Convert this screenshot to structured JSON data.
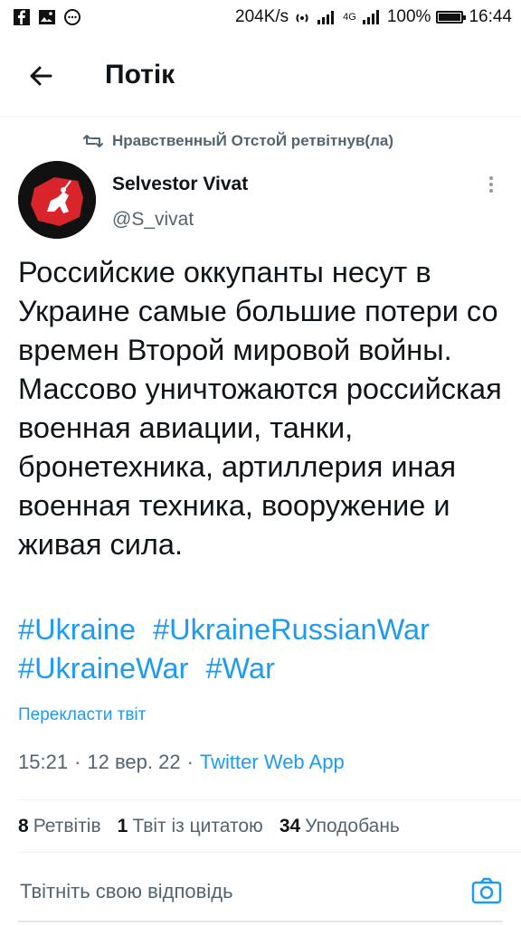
{
  "status_bar": {
    "speed": "204K/s",
    "network": "4G",
    "battery": "100%",
    "time": "16:44",
    "battery_level": 1.0,
    "left_icons": [
      "facebook-icon",
      "image-icon",
      "chat-icon"
    ]
  },
  "header": {
    "title": "Потік",
    "back_icon": "arrow-left-icon"
  },
  "retweet": {
    "text": "НравственныЙ ОтстоЙ ретвітнув(ла)",
    "icon": "retweet-icon"
  },
  "author": {
    "name": "Selvestor Vivat",
    "handle": "@S_vivat"
  },
  "tweet": {
    "body": "Российские оккупанты несут в Украине самые большие потери со времен Второй мировой войны. Массово уничтожаются российская военная авиации, танки, бронетехника, артиллерия иная военная техника, вооружение и живая сила.",
    "hashtags": [
      "#Ukraine",
      "#UkraineRussianWar",
      "#UkraineWar",
      "#War"
    ],
    "translate": "Перекласти твіт",
    "time": "15:21",
    "date": "12 вер. 22",
    "source": "Twitter Web App",
    "dot": "·"
  },
  "stats": {
    "retweets_count": "8",
    "retweets_label": "Ретвітів",
    "quotes_count": "1",
    "quotes_label": "Твіт із цитатою",
    "likes_count": "34",
    "likes_label": "Уподобань"
  },
  "reply": {
    "placeholder": "Твітніть свою відповідь",
    "camera_icon": "camera-icon"
  },
  "colors": {
    "accent": "#1d9bf0",
    "text": "#0f1419",
    "muted": "#536471",
    "avatar_red": "#d8242a"
  }
}
